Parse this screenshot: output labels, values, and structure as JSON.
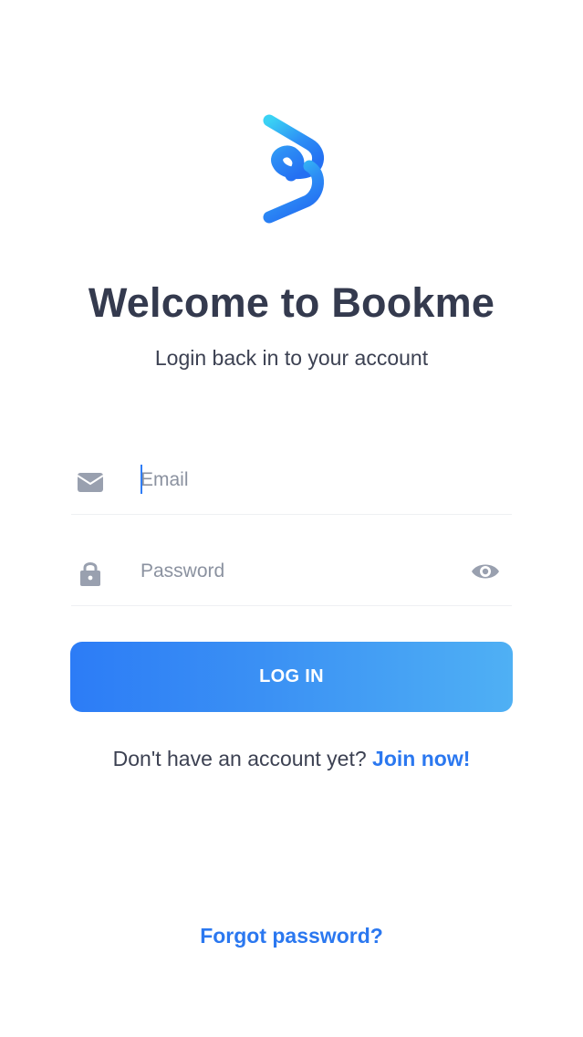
{
  "app": {
    "brand": "Bookme"
  },
  "header": {
    "title": "Welcome to Bookme",
    "subtitle": "Login back in to your account"
  },
  "form": {
    "email": {
      "placeholder": "Email",
      "value": "",
      "icon": "envelope-icon"
    },
    "password": {
      "placeholder": "Password",
      "value": "",
      "icon": "lock-icon",
      "toggle_icon": "eye-icon"
    },
    "login_label": "LOG IN"
  },
  "signup": {
    "prompt": "Don't have an account yet?",
    "link": "Join now!"
  },
  "forgot_label": "Forgot password?",
  "colors": {
    "accent": "#2b78f0",
    "button_start": "#2c7cf6",
    "button_end": "#4fb0f4",
    "title": "#343a4e",
    "icon": "#99a0af"
  }
}
